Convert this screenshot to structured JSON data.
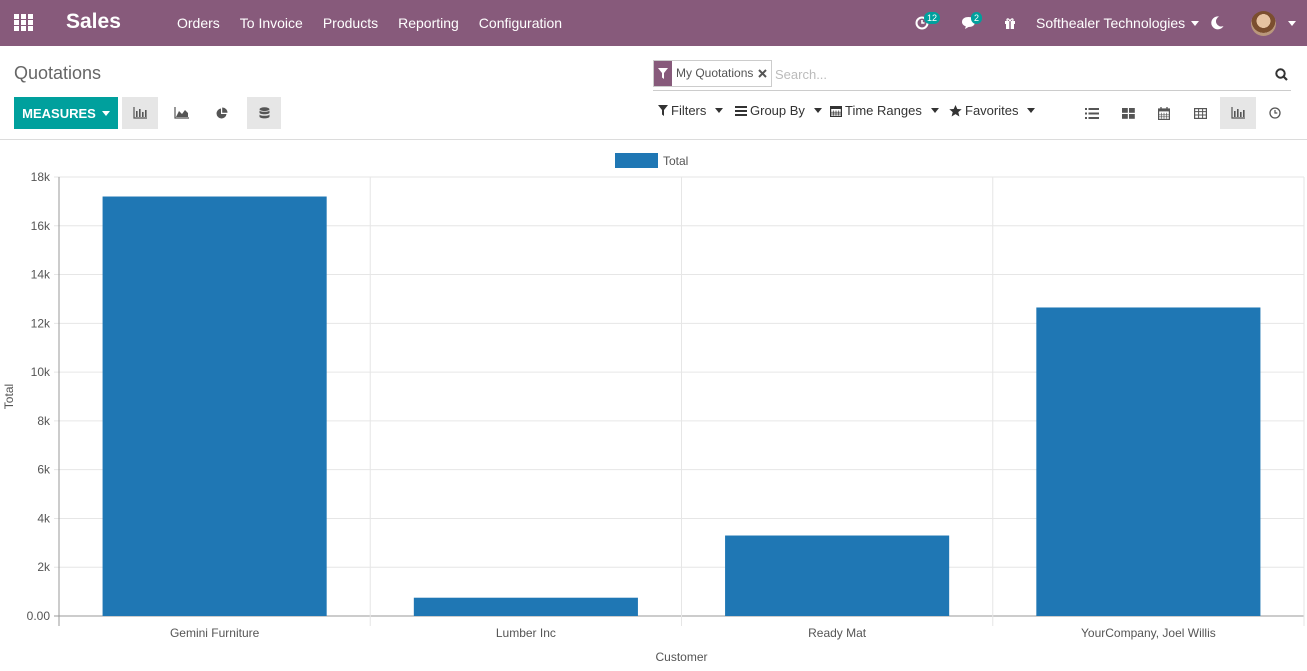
{
  "app": {
    "name": "Sales",
    "menu": [
      "Orders",
      "To Invoice",
      "Products",
      "Reporting",
      "Configuration"
    ],
    "activity_count": "12",
    "message_count": "2",
    "company": "Softhealer Technologies"
  },
  "view": {
    "title": "Quotations",
    "measures_label": "MEASURES",
    "search": {
      "facet": "My Quotations",
      "placeholder": "Search..."
    },
    "filters": {
      "filters_label": "Filters",
      "group_by_label": "Group By",
      "time_ranges_label": "Time Ranges",
      "favorites_label": "Favorites"
    }
  },
  "colors": {
    "navbar": "#875a7b",
    "accent": "#00a09d",
    "bar": "#1f77b4"
  },
  "chart_data": {
    "type": "bar",
    "categories": [
      "Gemini Furniture",
      "Lumber Inc",
      "Ready Mat",
      "YourCompany, Joel Willis"
    ],
    "series": [
      {
        "name": "Total",
        "values": [
          17200,
          750,
          3300,
          12650
        ]
      }
    ],
    "xlabel": "Customer",
    "ylabel": "Total",
    "ylim": [
      0,
      18000
    ],
    "yticks": [
      "0.00",
      "2k",
      "4k",
      "6k",
      "8k",
      "10k",
      "12k",
      "14k",
      "16k",
      "18k"
    ],
    "legend": "top-center",
    "grid": true
  }
}
